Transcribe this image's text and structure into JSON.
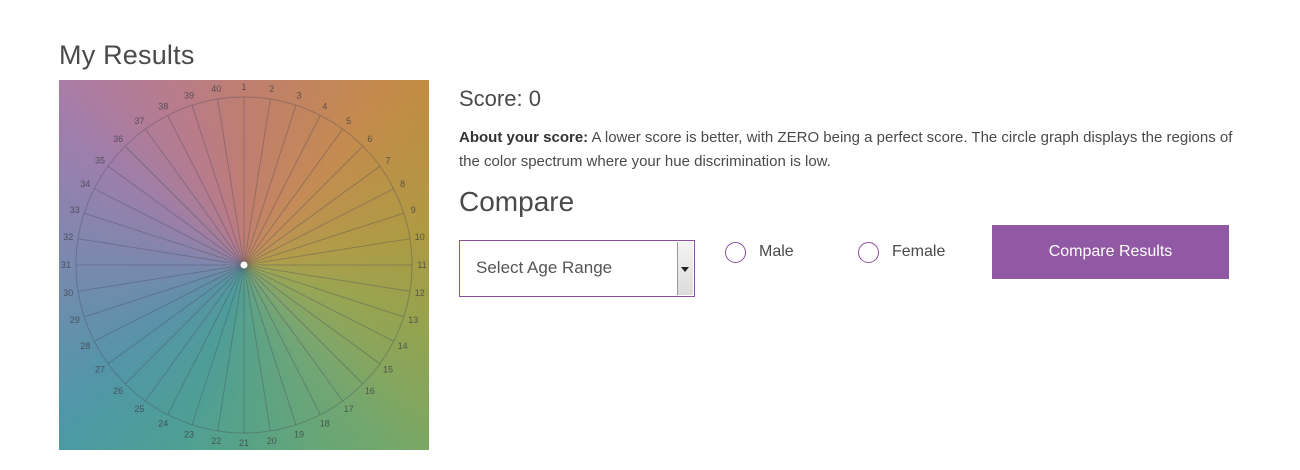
{
  "page": {
    "title": "My Results"
  },
  "results": {
    "score_label": "Score: 0",
    "about_bold": "About your score:",
    "about_text": " A lower score is better, with ZERO being a perfect score. The circle graph displays the regions of the color spectrum where your hue discrimination is low."
  },
  "wheel": {
    "labels": [
      "1",
      "2",
      "3",
      "4",
      "5",
      "6",
      "7",
      "8",
      "9",
      "10",
      "11",
      "12",
      "13",
      "14",
      "15",
      "16",
      "17",
      "18",
      "19",
      "20",
      "21",
      "22",
      "23",
      "24",
      "25",
      "26",
      "27",
      "28",
      "29",
      "30",
      "31",
      "32",
      "33",
      "34",
      "35",
      "36",
      "37",
      "38",
      "39",
      "40"
    ]
  },
  "compare": {
    "heading": "Compare",
    "age_select_placeholder": "Select Age Range",
    "male_label": "Male",
    "female_label": "Female",
    "button_label": "Compare Results"
  },
  "colors": {
    "accent": "#9159a4",
    "radio_border": "#8c4f9e",
    "text": "#4a4a4a"
  }
}
